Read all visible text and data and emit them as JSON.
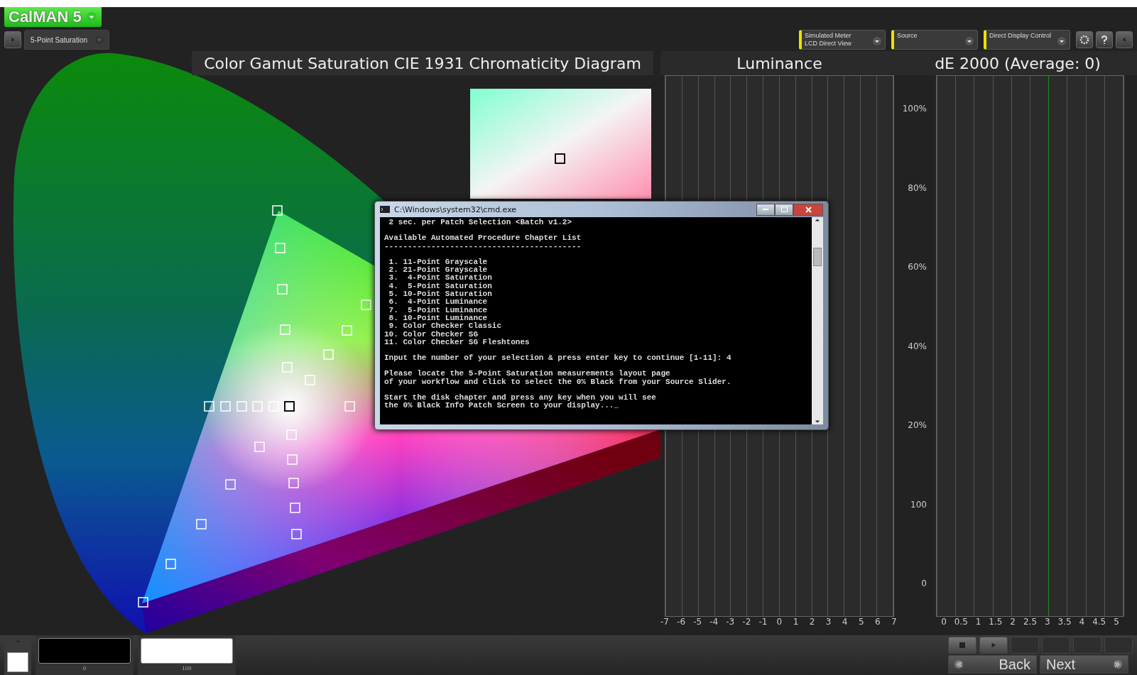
{
  "app": {
    "logo": "CalMAN 5"
  },
  "workflow_tab": {
    "label": "5-Point Saturation",
    "selected": true
  },
  "toolbar": {
    "dropdowns": [
      {
        "lines": [
          "Simulated Meter",
          "LCD Direct View"
        ]
      },
      {
        "lines": [
          "Source"
        ]
      },
      {
        "lines": [
          "Direct Display Control"
        ]
      }
    ]
  },
  "gamut_panel": {
    "title": "Color Gamut Saturation CIE 1931 Chromaticity Diagram"
  },
  "luminance_panel": {
    "title": "Luminance",
    "x_ticks": [
      "-7",
      "-6",
      "-5",
      "-4",
      "-3",
      "-2",
      "-1",
      "0",
      "1",
      "2",
      "3",
      "4",
      "5",
      "6",
      "7"
    ]
  },
  "de_panel": {
    "title": "dE 2000 (Average: 0)",
    "y_ticks": [
      "100%",
      "80%",
      "60%",
      "40%",
      "20%",
      "100",
      "0"
    ],
    "x_ticks": [
      "0",
      "0.5",
      "1",
      "1.5",
      "2",
      "2.5",
      "3",
      "3.5",
      "4",
      "4.5",
      "5"
    ]
  },
  "console": {
    "title": "C:\\Windows\\system32\\cmd.exe",
    "lines": [
      {
        "text": " 2 sec. per Patch Selection <Batch v1.2>",
        "gap": false
      },
      {
        "text": "Available Automated Procedure Chapter List",
        "gap": true
      },
      {
        "text": "------------------------------------------",
        "gap": false
      },
      {
        "text": " 1. 11-Point Grayscale",
        "gap": true
      },
      {
        "text": " 2. 21-Point Grayscale",
        "gap": false
      },
      {
        "text": " 3.  4-Point Saturation",
        "gap": false
      },
      {
        "text": " 4.  5-Point Saturation",
        "gap": false
      },
      {
        "text": " 5. 10-Point Saturation",
        "gap": false
      },
      {
        "text": " 6.  4-Point Luminance",
        "gap": false
      },
      {
        "text": " 7.  5-Point Luminance",
        "gap": false
      },
      {
        "text": " 8. 10-Point Luminance",
        "gap": false
      },
      {
        "text": " 9. Color Checker Classic",
        "gap": false
      },
      {
        "text": "10. Color Checker SG",
        "gap": false
      },
      {
        "text": "11. Color Checker SG Fleshtones",
        "gap": false
      },
      {
        "text": "Input the number of your selection & press enter key to continue [1-11]: 4",
        "gap": true
      },
      {
        "text": "Please locate the 5-Point Saturation measurements layout page",
        "gap": true
      },
      {
        "text": "of your workflow and click to select the 0% Black from your Source Slider.",
        "gap": false
      },
      {
        "text": "Start the disk chapter and press any key when you will see",
        "gap": true
      },
      {
        "text": "the 0% Black Info Patch Screen to your display..._",
        "gap": false
      }
    ]
  },
  "source_slider": {
    "patches": [
      {
        "label": "0",
        "color": "#000000"
      },
      {
        "label": "100",
        "color": "#ffffff"
      }
    ]
  },
  "navigation": {
    "back": "Back",
    "next": "Next"
  }
}
